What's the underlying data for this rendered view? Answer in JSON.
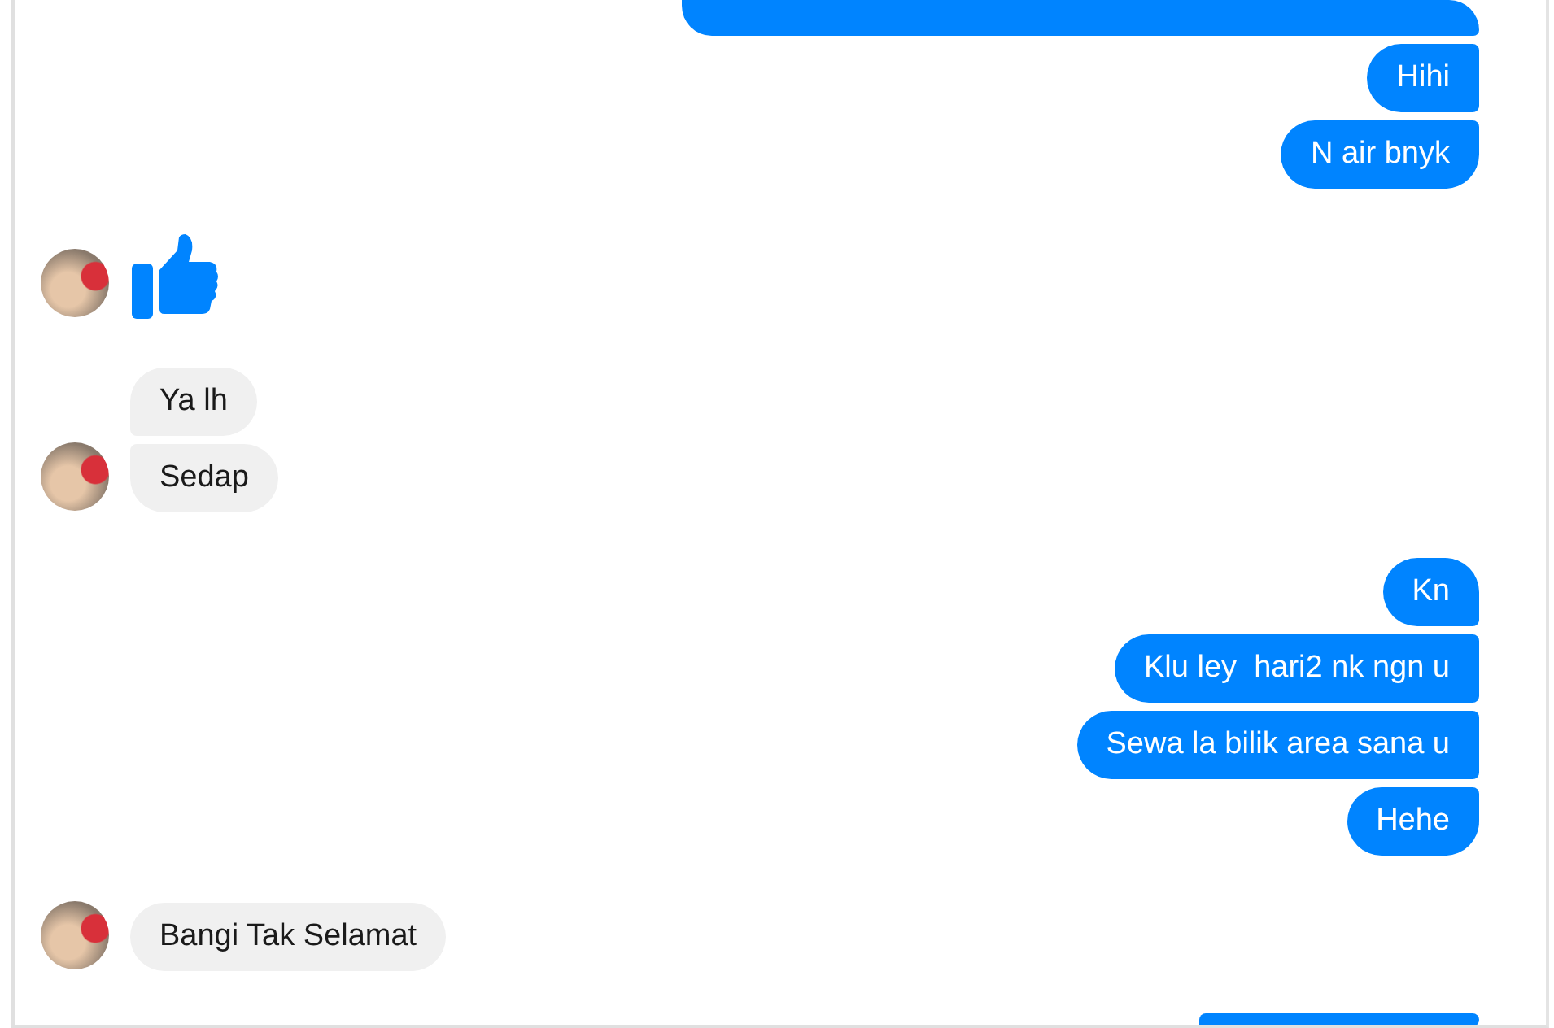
{
  "groups": [
    {
      "kind": "outgoing",
      "messages": [
        {
          "kind": "partial"
        },
        {
          "kind": "text",
          "text": "Hihi"
        },
        {
          "kind": "text",
          "text": "N air bnyk"
        }
      ]
    },
    {
      "kind": "incoming",
      "messages": [
        {
          "kind": "like"
        }
      ]
    },
    {
      "kind": "incoming",
      "messages": [
        {
          "kind": "text",
          "text": "Ya lh"
        },
        {
          "kind": "text",
          "text": "Sedap"
        }
      ]
    },
    {
      "kind": "outgoing",
      "messages": [
        {
          "kind": "text",
          "text": "Kn"
        },
        {
          "kind": "text",
          "text": "Klu ley  hari2 nk ngn u"
        },
        {
          "kind": "text",
          "text": "Sewa la bilik area sana u"
        },
        {
          "kind": "text",
          "text": "Hehe"
        }
      ]
    },
    {
      "kind": "incoming",
      "messages": [
        {
          "kind": "text",
          "text": "Bangi Tak Selamat"
        }
      ]
    },
    {
      "kind": "outgoing",
      "messages": [
        {
          "kind": "partial"
        }
      ]
    }
  ]
}
